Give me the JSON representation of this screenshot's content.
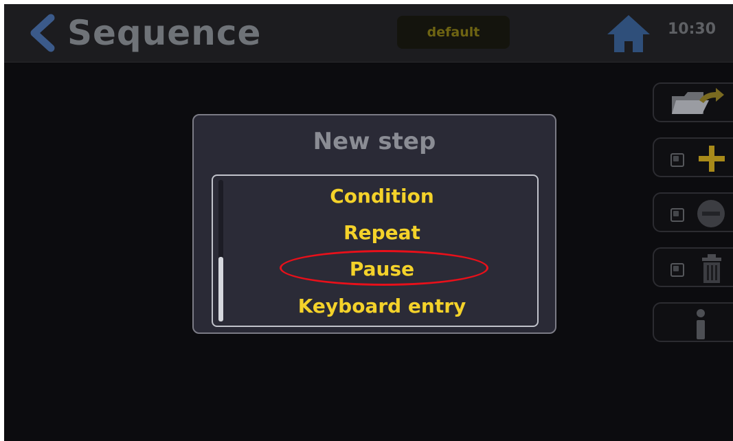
{
  "header": {
    "title": "Sequence",
    "profile_label": "default",
    "clock": "10:30"
  },
  "side_toolbar": {
    "buttons": [
      {
        "name": "open-folder",
        "icon": "folder-export-icon"
      },
      {
        "name": "add",
        "icon": "plus-icon"
      },
      {
        "name": "remove",
        "icon": "minus-circle-icon"
      },
      {
        "name": "delete",
        "icon": "trash-icon"
      },
      {
        "name": "info",
        "icon": "info-icon"
      }
    ]
  },
  "modal": {
    "title": "New step",
    "items": [
      "Condition",
      "Repeat",
      "Pause",
      "Keyboard entry"
    ],
    "highlighted_item": "Pause"
  },
  "colors": {
    "accent_yellow": "#f4d22a",
    "highlight_red": "#e8101a",
    "background": "#0c0c0f"
  }
}
